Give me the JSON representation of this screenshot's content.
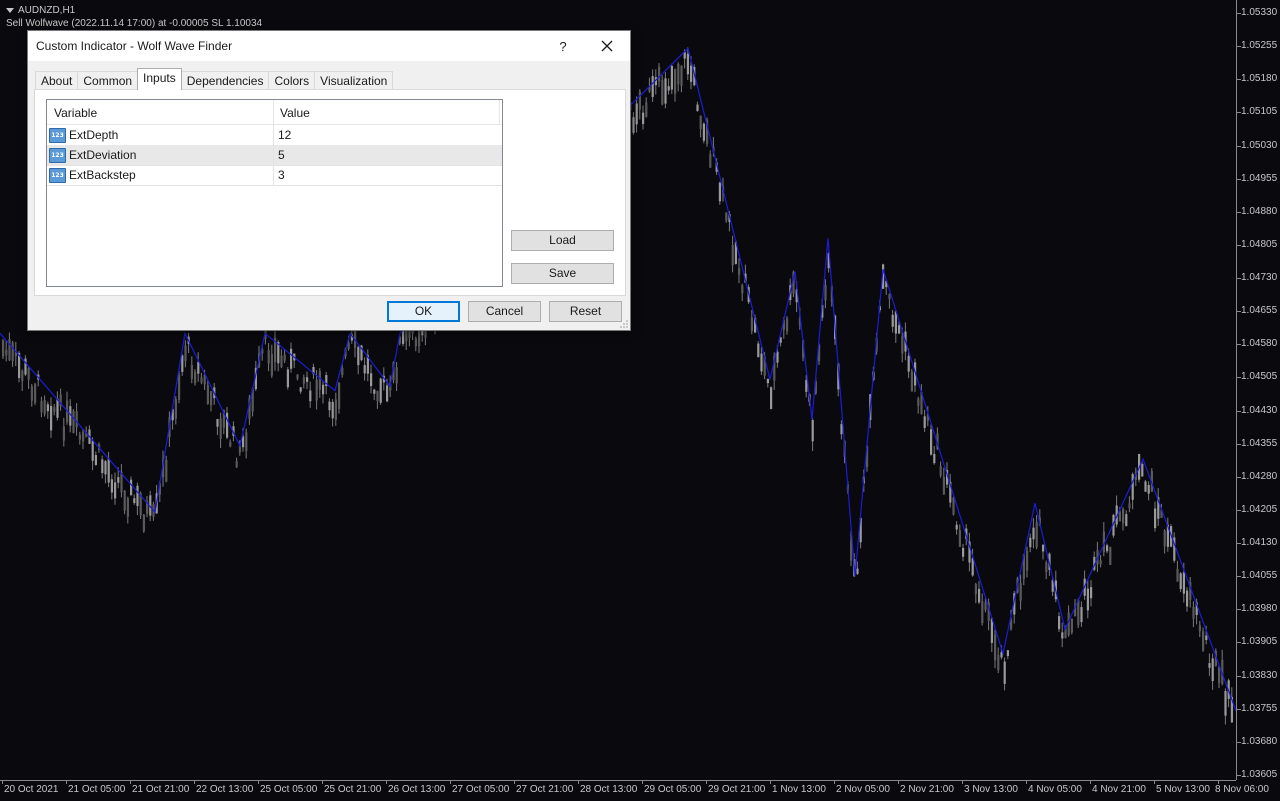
{
  "chart": {
    "symbol": "AUDNZD,H1",
    "signal_text": "Sell Wolfwave (2022.11.14 17:00) at -0.00005 SL 1.10034",
    "colors": {
      "background": "#0a0a0e",
      "candle": "#8c8c8c",
      "zigzag": "#1c1cd8",
      "axis_text": "#c8c8c8"
    },
    "price_labels": [
      "1.05330",
      "1.05255",
      "1.05180",
      "1.05105",
      "1.05030",
      "1.04955",
      "1.04880",
      "1.04805",
      "1.04730",
      "1.04655",
      "1.04580",
      "1.04505",
      "1.04430",
      "1.04355",
      "1.04280",
      "1.04205",
      "1.04130",
      "1.04055",
      "1.03980",
      "1.03905",
      "1.03830",
      "1.03755",
      "1.03680",
      "1.03605"
    ],
    "time_labels": [
      "20 Oct 2021",
      "21 Oct 05:00",
      "21 Oct 21:00",
      "22 Oct 13:00",
      "25 Oct 05:00",
      "25 Oct 21:00",
      "26 Oct 13:00",
      "27 Oct 05:00",
      "27 Oct 21:00",
      "28 Oct 13:00",
      "29 Oct 05:00",
      "29 Oct 21:00",
      "1 Nov 13:00",
      "2 Nov 05:00",
      "2 Nov 21:00",
      "3 Nov 13:00",
      "4 Nov 05:00",
      "4 Nov 21:00",
      "5 Nov 13:00",
      "8 Nov 06:00"
    ],
    "zigzag_prices": [
      1.04605,
      1.042,
      1.04605,
      1.0435,
      1.04605,
      1.04475,
      1.04605,
      1.04485,
      1.04605,
      1.0525,
      1.045,
      1.04745,
      1.0441,
      1.0482,
      1.04055,
      1.0475,
      1.0388,
      1.0422,
      1.03935,
      1.0432,
      1.0375
    ]
  },
  "dialog": {
    "title": "Custom Indicator - Wolf Wave Finder",
    "help_label": "?",
    "tabs": [
      "About",
      "Common",
      "Inputs",
      "Dependencies",
      "Colors",
      "Visualization"
    ],
    "active_tab": "Inputs",
    "table": {
      "headers": [
        "Variable",
        "Value"
      ],
      "rows": [
        {
          "icon": "123",
          "variable": "ExtDepth",
          "value": "12"
        },
        {
          "icon": "123",
          "variable": "ExtDeviation",
          "value": "5"
        },
        {
          "icon": "123",
          "variable": "ExtBackstep",
          "value": "3"
        }
      ]
    },
    "buttons": {
      "load": "Load",
      "save": "Save",
      "ok": "OK",
      "cancel": "Cancel",
      "reset": "Reset"
    }
  }
}
